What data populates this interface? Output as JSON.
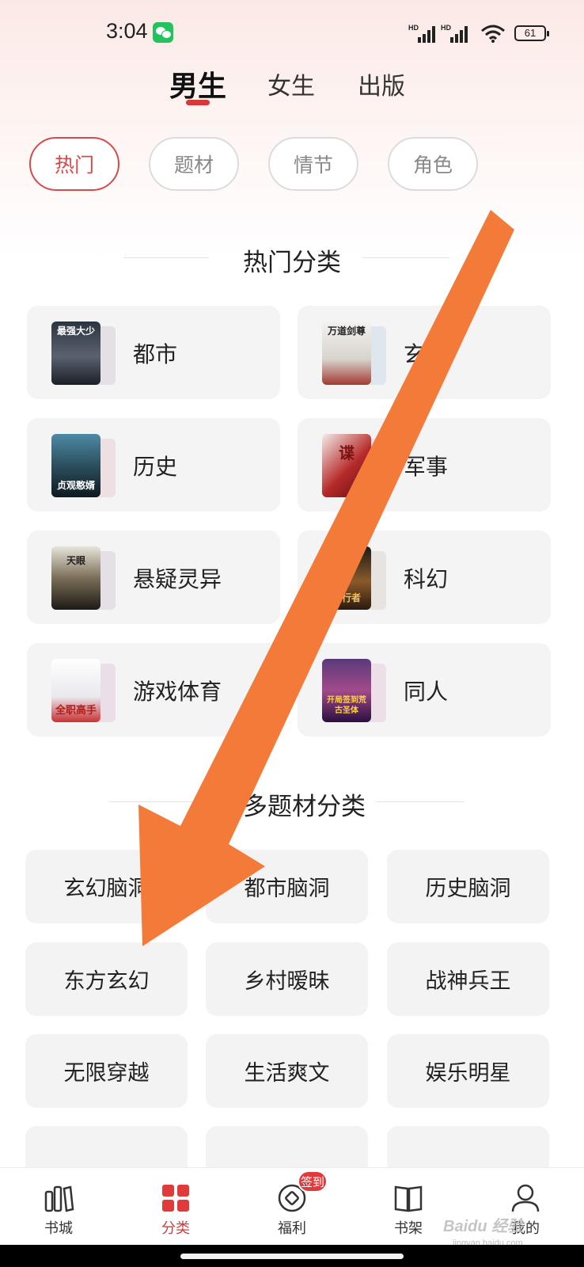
{
  "status_bar": {
    "time": "3:04",
    "battery": "61",
    "signal_label": "HD"
  },
  "gender_tabs": [
    {
      "label": "男生",
      "active": true
    },
    {
      "label": "女生",
      "active": false
    },
    {
      "label": "出版",
      "active": false
    }
  ],
  "filter_chips": [
    {
      "label": "热门",
      "active": true
    },
    {
      "label": "题材",
      "active": false
    },
    {
      "label": "情节",
      "active": false
    },
    {
      "label": "角色",
      "active": false
    }
  ],
  "hot_section": {
    "title": "热门分类",
    "items": [
      {
        "label": "都市",
        "cover_text": "最强大少"
      },
      {
        "label": "玄幻",
        "cover_text": "万道剑尊"
      },
      {
        "label": "历史",
        "cover_text": "贞观憨婿"
      },
      {
        "label": "军事",
        "cover_text": "谍"
      },
      {
        "label": "悬疑灵异",
        "cover_text": "天眼"
      },
      {
        "label": "科幻",
        "cover_text": "逆行者"
      },
      {
        "label": "游戏体育",
        "cover_text": "全职高手"
      },
      {
        "label": "同人",
        "cover_text": "开局签到荒古圣体"
      }
    ]
  },
  "genre_section": {
    "title": "更多题材分类",
    "items": [
      "玄幻脑洞",
      "都市脑洞",
      "历史脑洞",
      "东方玄幻",
      "乡村暧昧",
      "战神兵王",
      "无限穿越",
      "生活爽文",
      "娱乐明星"
    ]
  },
  "bottom_nav": {
    "items": [
      {
        "label": "书城",
        "icon": "bookstore-icon",
        "active": false
      },
      {
        "label": "分类",
        "icon": "category-grid-icon",
        "active": true
      },
      {
        "label": "福利",
        "icon": "coin-icon",
        "active": false
      },
      {
        "label": "书架",
        "icon": "bookshelf-icon",
        "active": false
      },
      {
        "label": "我的",
        "icon": "profile-icon",
        "active": false
      }
    ],
    "badge": "签到"
  },
  "watermark": "Baidu 经验",
  "watermark_sub": "jingyan.baidu.com",
  "colors": {
    "accent": "#d93838",
    "arrow": "#f47a3a",
    "card_bg": "#f4f4f5"
  }
}
